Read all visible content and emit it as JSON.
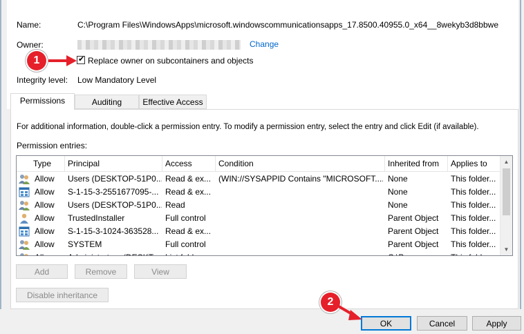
{
  "fields": {
    "name_label": "Name:",
    "name_value": "C:\\Program Files\\WindowsApps\\microsoft.windowscommunicationsapps_17.8500.40955.0_x64__8wekyb3d8bbwe",
    "owner_label": "Owner:",
    "change_link": "Change",
    "replace_owner_label": "Replace owner on subcontainers and objects",
    "replace_owner_checked": true,
    "integrity_label": "Integrity level:",
    "integrity_value": "Low Mandatory Level"
  },
  "callouts": {
    "one": "1",
    "two": "2"
  },
  "tabs": [
    {
      "label": "Permissions",
      "active": true
    },
    {
      "label": "Auditing",
      "active": false
    },
    {
      "label": "Effective Access",
      "active": false
    }
  ],
  "panel": {
    "info_text": "For additional information, double-click a permission entry. To modify a permission entry, select the entry and click Edit (if available).",
    "entries_label": "Permission entries:"
  },
  "table": {
    "columns": [
      "Type",
      "Principal",
      "Access",
      "Condition",
      "Inherited from",
      "Applies to"
    ],
    "rows": [
      {
        "icon": "users-icon",
        "type": "Allow",
        "principal": "Users (DESKTOP-51P0...",
        "access": "Read & ex...",
        "condition": "(WIN://SYSAPPID Contains \"MICROSOFT....",
        "inherited": "None",
        "applies": "This folder..."
      },
      {
        "icon": "app-package-icon",
        "type": "Allow",
        "principal": "S-1-15-3-2551677095-...",
        "access": "Read & ex...",
        "condition": "",
        "inherited": "None",
        "applies": "This folder..."
      },
      {
        "icon": "users-icon",
        "type": "Allow",
        "principal": "Users (DESKTOP-51P0...",
        "access": "Read",
        "condition": "",
        "inherited": "None",
        "applies": "This folder..."
      },
      {
        "icon": "user-icon",
        "type": "Allow",
        "principal": "TrustedInstaller",
        "access": "Full control",
        "condition": "",
        "inherited": "Parent Object",
        "applies": "This folder..."
      },
      {
        "icon": "app-package-icon",
        "type": "Allow",
        "principal": "S-1-15-3-1024-363528...",
        "access": "Read & ex...",
        "condition": "",
        "inherited": "Parent Object",
        "applies": "This folder..."
      },
      {
        "icon": "users-icon",
        "type": "Allow",
        "principal": "SYSTEM",
        "access": "Full control",
        "condition": "",
        "inherited": "Parent Object",
        "applies": "This folder..."
      },
      {
        "icon": "users-icon",
        "type": "Allow",
        "principal": "Administrators (DESKT...",
        "access": "List folder...",
        "condition": "",
        "inherited": "C:\\Program...",
        "applies": "This folder..."
      }
    ]
  },
  "buttons": {
    "add": "Add",
    "remove": "Remove",
    "view": "View",
    "disable_inheritance": "Disable inheritance",
    "ok": "OK",
    "cancel": "Cancel",
    "apply": "Apply"
  },
  "colors": {
    "callout": "#e5202a",
    "link": "#0066cc",
    "ok_border": "#0078d7"
  }
}
